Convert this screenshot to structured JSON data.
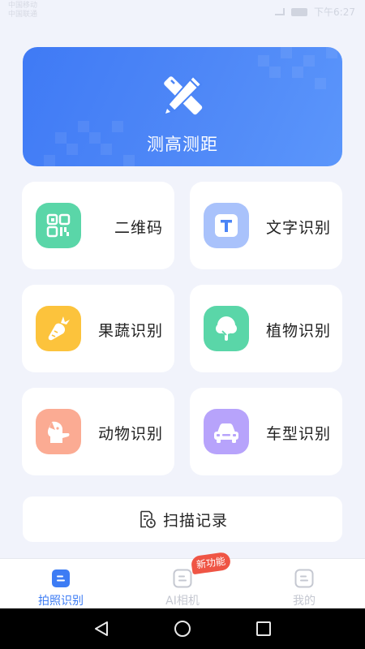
{
  "status_bar": {
    "carrier_line1": "中国移动",
    "carrier_line2": "中国联通",
    "time": "下午6:27"
  },
  "hero": {
    "title": "测高测距",
    "icon": "pencil-ruler-icon",
    "color": "#4a84f6"
  },
  "features": [
    {
      "label": "二维码",
      "icon": "qr-code-icon",
      "color": "#5ad6a8"
    },
    {
      "label": "文字识别",
      "icon": "text-t-icon",
      "color": "#a9c2fb"
    },
    {
      "label": "果蔬识别",
      "icon": "carrot-icon",
      "color": "#fcc33c"
    },
    {
      "label": "植物识别",
      "icon": "tree-icon",
      "color": "#5ad6a8"
    },
    {
      "label": "动物识别",
      "icon": "dog-icon",
      "color": "#fbab93"
    },
    {
      "label": "车型识别",
      "icon": "car-icon",
      "color": "#b7a3fb"
    }
  ],
  "scan_records": {
    "label": "扫描记录",
    "icon": "document-clock-icon"
  },
  "tabs": [
    {
      "label": "拍照识别",
      "icon": "photo-recognize-icon",
      "active": true
    },
    {
      "label": "AI相机",
      "icon": "ai-camera-icon",
      "badge": "新功能"
    },
    {
      "label": "我的",
      "icon": "profile-icon"
    }
  ],
  "colors": {
    "accent": "#3d7cf4",
    "background": "#f1f3fb",
    "badge": "#ef5545"
  }
}
